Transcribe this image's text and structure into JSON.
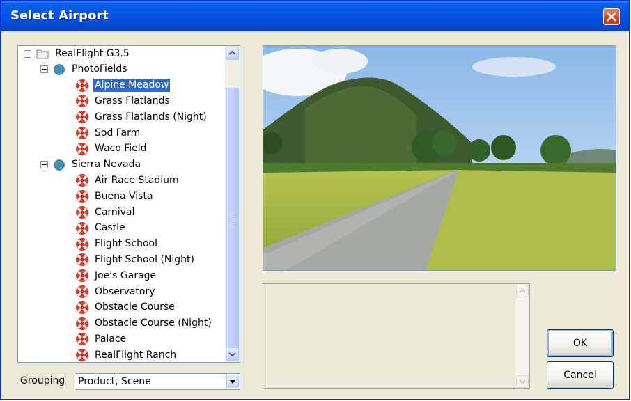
{
  "window": {
    "title": "Select Airport"
  },
  "tree": {
    "root": {
      "label": "RealFlight G3.5"
    },
    "groups": [
      {
        "label": "PhotoFields",
        "items": [
          "Alpine Meadow",
          "Grass Flatlands",
          "Grass Flatlands (Night)",
          "Sod Farm",
          "Waco Field"
        ]
      },
      {
        "label": "Sierra Nevada",
        "items": [
          "Air Race Stadium",
          "Buena Vista",
          "Carnival",
          "Castle",
          "Flight School",
          "Flight School (Night)",
          "Joe's Garage",
          "Observatory",
          "Obstacle Course",
          "Obstacle Course (Night)",
          "Palace",
          "RealFlight Ranch"
        ]
      }
    ],
    "selected": "Alpine Meadow"
  },
  "grouping": {
    "label": "Grouping",
    "value": "Product, Scene"
  },
  "buttons": {
    "ok": "OK",
    "cancel": "Cancel"
  },
  "icons": {
    "root": "folder-icon",
    "group": "globe-icon",
    "airport": "airport-icon",
    "close": "close-icon"
  },
  "colors": {
    "titlebar": "#0554e3",
    "selection": "#316ac5",
    "close": "#d0451b"
  }
}
